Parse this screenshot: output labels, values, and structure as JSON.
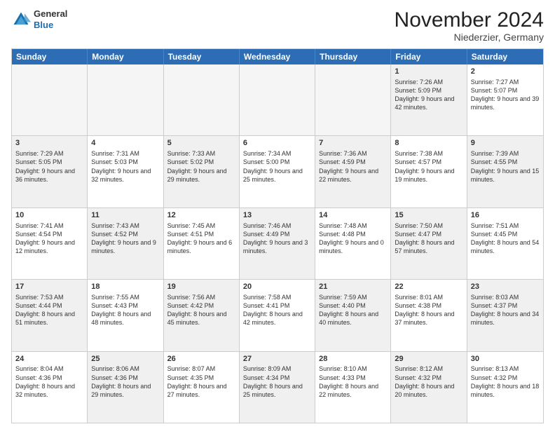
{
  "logo": {
    "general": "General",
    "blue": "Blue"
  },
  "title": "November 2024",
  "location": "Niederzier, Germany",
  "header_days": [
    "Sunday",
    "Monday",
    "Tuesday",
    "Wednesday",
    "Thursday",
    "Friday",
    "Saturday"
  ],
  "rows": [
    [
      {
        "day": "",
        "text": "",
        "empty": true
      },
      {
        "day": "",
        "text": "",
        "empty": true
      },
      {
        "day": "",
        "text": "",
        "empty": true
      },
      {
        "day": "",
        "text": "",
        "empty": true
      },
      {
        "day": "",
        "text": "",
        "empty": true
      },
      {
        "day": "1",
        "text": "Sunrise: 7:26 AM\nSunset: 5:09 PM\nDaylight: 9 hours and 42 minutes.",
        "shaded": true
      },
      {
        "day": "2",
        "text": "Sunrise: 7:27 AM\nSunset: 5:07 PM\nDaylight: 9 hours and 39 minutes.",
        "shaded": false
      }
    ],
    [
      {
        "day": "3",
        "text": "Sunrise: 7:29 AM\nSunset: 5:05 PM\nDaylight: 9 hours and 36 minutes.",
        "shaded": true
      },
      {
        "day": "4",
        "text": "Sunrise: 7:31 AM\nSunset: 5:03 PM\nDaylight: 9 hours and 32 minutes.",
        "shaded": false
      },
      {
        "day": "5",
        "text": "Sunrise: 7:33 AM\nSunset: 5:02 PM\nDaylight: 9 hours and 29 minutes.",
        "shaded": true
      },
      {
        "day": "6",
        "text": "Sunrise: 7:34 AM\nSunset: 5:00 PM\nDaylight: 9 hours and 25 minutes.",
        "shaded": false
      },
      {
        "day": "7",
        "text": "Sunrise: 7:36 AM\nSunset: 4:59 PM\nDaylight: 9 hours and 22 minutes.",
        "shaded": true
      },
      {
        "day": "8",
        "text": "Sunrise: 7:38 AM\nSunset: 4:57 PM\nDaylight: 9 hours and 19 minutes.",
        "shaded": false
      },
      {
        "day": "9",
        "text": "Sunrise: 7:39 AM\nSunset: 4:55 PM\nDaylight: 9 hours and 15 minutes.",
        "shaded": true
      }
    ],
    [
      {
        "day": "10",
        "text": "Sunrise: 7:41 AM\nSunset: 4:54 PM\nDaylight: 9 hours and 12 minutes.",
        "shaded": false
      },
      {
        "day": "11",
        "text": "Sunrise: 7:43 AM\nSunset: 4:52 PM\nDaylight: 9 hours and 9 minutes.",
        "shaded": true
      },
      {
        "day": "12",
        "text": "Sunrise: 7:45 AM\nSunset: 4:51 PM\nDaylight: 9 hours and 6 minutes.",
        "shaded": false
      },
      {
        "day": "13",
        "text": "Sunrise: 7:46 AM\nSunset: 4:49 PM\nDaylight: 9 hours and 3 minutes.",
        "shaded": true
      },
      {
        "day": "14",
        "text": "Sunrise: 7:48 AM\nSunset: 4:48 PM\nDaylight: 9 hours and 0 minutes.",
        "shaded": false
      },
      {
        "day": "15",
        "text": "Sunrise: 7:50 AM\nSunset: 4:47 PM\nDaylight: 8 hours and 57 minutes.",
        "shaded": true
      },
      {
        "day": "16",
        "text": "Sunrise: 7:51 AM\nSunset: 4:45 PM\nDaylight: 8 hours and 54 minutes.",
        "shaded": false
      }
    ],
    [
      {
        "day": "17",
        "text": "Sunrise: 7:53 AM\nSunset: 4:44 PM\nDaylight: 8 hours and 51 minutes.",
        "shaded": true
      },
      {
        "day": "18",
        "text": "Sunrise: 7:55 AM\nSunset: 4:43 PM\nDaylight: 8 hours and 48 minutes.",
        "shaded": false
      },
      {
        "day": "19",
        "text": "Sunrise: 7:56 AM\nSunset: 4:42 PM\nDaylight: 8 hours and 45 minutes.",
        "shaded": true
      },
      {
        "day": "20",
        "text": "Sunrise: 7:58 AM\nSunset: 4:41 PM\nDaylight: 8 hours and 42 minutes.",
        "shaded": false
      },
      {
        "day": "21",
        "text": "Sunrise: 7:59 AM\nSunset: 4:40 PM\nDaylight: 8 hours and 40 minutes.",
        "shaded": true
      },
      {
        "day": "22",
        "text": "Sunrise: 8:01 AM\nSunset: 4:38 PM\nDaylight: 8 hours and 37 minutes.",
        "shaded": false
      },
      {
        "day": "23",
        "text": "Sunrise: 8:03 AM\nSunset: 4:37 PM\nDaylight: 8 hours and 34 minutes.",
        "shaded": true
      }
    ],
    [
      {
        "day": "24",
        "text": "Sunrise: 8:04 AM\nSunset: 4:36 PM\nDaylight: 8 hours and 32 minutes.",
        "shaded": false
      },
      {
        "day": "25",
        "text": "Sunrise: 8:06 AM\nSunset: 4:36 PM\nDaylight: 8 hours and 29 minutes.",
        "shaded": true
      },
      {
        "day": "26",
        "text": "Sunrise: 8:07 AM\nSunset: 4:35 PM\nDaylight: 8 hours and 27 minutes.",
        "shaded": false
      },
      {
        "day": "27",
        "text": "Sunrise: 8:09 AM\nSunset: 4:34 PM\nDaylight: 8 hours and 25 minutes.",
        "shaded": true
      },
      {
        "day": "28",
        "text": "Sunrise: 8:10 AM\nSunset: 4:33 PM\nDaylight: 8 hours and 22 minutes.",
        "shaded": false
      },
      {
        "day": "29",
        "text": "Sunrise: 8:12 AM\nSunset: 4:32 PM\nDaylight: 8 hours and 20 minutes.",
        "shaded": true
      },
      {
        "day": "30",
        "text": "Sunrise: 8:13 AM\nSunset: 4:32 PM\nDaylight: 8 hours and 18 minutes.",
        "shaded": false
      }
    ]
  ]
}
